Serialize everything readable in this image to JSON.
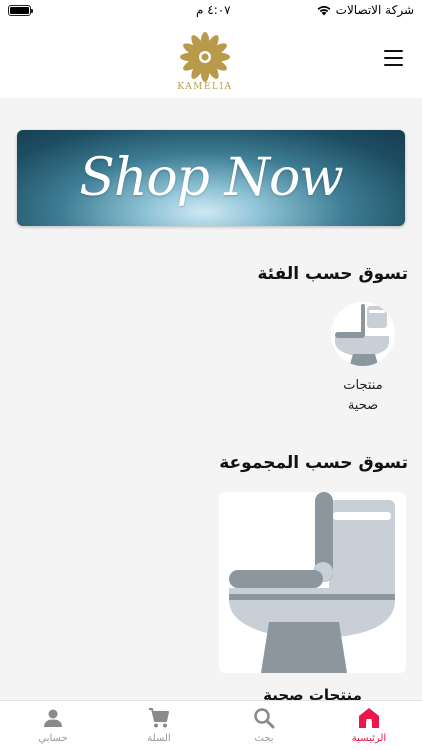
{
  "status_bar": {
    "carrier": "شركة الاتصالات",
    "time": "٤:٠٧ م"
  },
  "header": {
    "logo_text": "KAMELIA",
    "menu_icon": "hamburger-menu-icon"
  },
  "banner": {
    "text": "Shop Now"
  },
  "category_section": {
    "title": "تسوق حسب الفئة",
    "items": [
      {
        "label_line1": "منتجات",
        "label_line2": "صحية",
        "icon": "toilet-icon"
      }
    ]
  },
  "collection_section": {
    "title": "تسوق حسب المجموعة",
    "items": [
      {
        "label": "منتجات صحية",
        "icon": "toilet-icon"
      }
    ]
  },
  "bottom_nav": {
    "items": [
      {
        "label": "الرئيسية",
        "icon": "home-icon",
        "active": true
      },
      {
        "label": "بحث",
        "icon": "search-icon",
        "active": false
      },
      {
        "label": "السلة",
        "icon": "cart-icon",
        "active": false
      },
      {
        "label": "حسابي",
        "icon": "person-icon",
        "active": false
      }
    ]
  },
  "colors": {
    "accent": "#e8184a",
    "brand_gold": "#b89a4a",
    "inactive": "#9a9a9a"
  }
}
